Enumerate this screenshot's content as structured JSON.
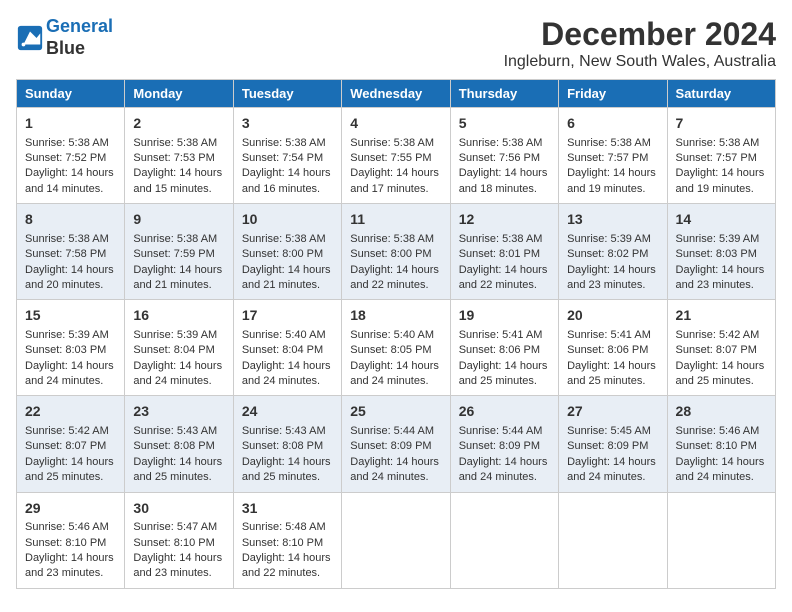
{
  "logo": {
    "line1": "General",
    "line2": "Blue"
  },
  "title": "December 2024",
  "subtitle": "Ingleburn, New South Wales, Australia",
  "days_of_week": [
    "Sunday",
    "Monday",
    "Tuesday",
    "Wednesday",
    "Thursday",
    "Friday",
    "Saturday"
  ],
  "weeks": [
    [
      {
        "day": "1",
        "sunrise": "5:38 AM",
        "sunset": "7:52 PM",
        "daylight": "14 hours and 14 minutes."
      },
      {
        "day": "2",
        "sunrise": "5:38 AM",
        "sunset": "7:53 PM",
        "daylight": "14 hours and 15 minutes."
      },
      {
        "day": "3",
        "sunrise": "5:38 AM",
        "sunset": "7:54 PM",
        "daylight": "14 hours and 16 minutes."
      },
      {
        "day": "4",
        "sunrise": "5:38 AM",
        "sunset": "7:55 PM",
        "daylight": "14 hours and 17 minutes."
      },
      {
        "day": "5",
        "sunrise": "5:38 AM",
        "sunset": "7:56 PM",
        "daylight": "14 hours and 18 minutes."
      },
      {
        "day": "6",
        "sunrise": "5:38 AM",
        "sunset": "7:57 PM",
        "daylight": "14 hours and 19 minutes."
      },
      {
        "day": "7",
        "sunrise": "5:38 AM",
        "sunset": "7:57 PM",
        "daylight": "14 hours and 19 minutes."
      }
    ],
    [
      {
        "day": "8",
        "sunrise": "5:38 AM",
        "sunset": "7:58 PM",
        "daylight": "14 hours and 20 minutes."
      },
      {
        "day": "9",
        "sunrise": "5:38 AM",
        "sunset": "7:59 PM",
        "daylight": "14 hours and 21 minutes."
      },
      {
        "day": "10",
        "sunrise": "5:38 AM",
        "sunset": "8:00 PM",
        "daylight": "14 hours and 21 minutes."
      },
      {
        "day": "11",
        "sunrise": "5:38 AM",
        "sunset": "8:00 PM",
        "daylight": "14 hours and 22 minutes."
      },
      {
        "day": "12",
        "sunrise": "5:38 AM",
        "sunset": "8:01 PM",
        "daylight": "14 hours and 22 minutes."
      },
      {
        "day": "13",
        "sunrise": "5:39 AM",
        "sunset": "8:02 PM",
        "daylight": "14 hours and 23 minutes."
      },
      {
        "day": "14",
        "sunrise": "5:39 AM",
        "sunset": "8:03 PM",
        "daylight": "14 hours and 23 minutes."
      }
    ],
    [
      {
        "day": "15",
        "sunrise": "5:39 AM",
        "sunset": "8:03 PM",
        "daylight": "14 hours and 24 minutes."
      },
      {
        "day": "16",
        "sunrise": "5:39 AM",
        "sunset": "8:04 PM",
        "daylight": "14 hours and 24 minutes."
      },
      {
        "day": "17",
        "sunrise": "5:40 AM",
        "sunset": "8:04 PM",
        "daylight": "14 hours and 24 minutes."
      },
      {
        "day": "18",
        "sunrise": "5:40 AM",
        "sunset": "8:05 PM",
        "daylight": "14 hours and 24 minutes."
      },
      {
        "day": "19",
        "sunrise": "5:41 AM",
        "sunset": "8:06 PM",
        "daylight": "14 hours and 25 minutes."
      },
      {
        "day": "20",
        "sunrise": "5:41 AM",
        "sunset": "8:06 PM",
        "daylight": "14 hours and 25 minutes."
      },
      {
        "day": "21",
        "sunrise": "5:42 AM",
        "sunset": "8:07 PM",
        "daylight": "14 hours and 25 minutes."
      }
    ],
    [
      {
        "day": "22",
        "sunrise": "5:42 AM",
        "sunset": "8:07 PM",
        "daylight": "14 hours and 25 minutes."
      },
      {
        "day": "23",
        "sunrise": "5:43 AM",
        "sunset": "8:08 PM",
        "daylight": "14 hours and 25 minutes."
      },
      {
        "day": "24",
        "sunrise": "5:43 AM",
        "sunset": "8:08 PM",
        "daylight": "14 hours and 25 minutes."
      },
      {
        "day": "25",
        "sunrise": "5:44 AM",
        "sunset": "8:09 PM",
        "daylight": "14 hours and 24 minutes."
      },
      {
        "day": "26",
        "sunrise": "5:44 AM",
        "sunset": "8:09 PM",
        "daylight": "14 hours and 24 minutes."
      },
      {
        "day": "27",
        "sunrise": "5:45 AM",
        "sunset": "8:09 PM",
        "daylight": "14 hours and 24 minutes."
      },
      {
        "day": "28",
        "sunrise": "5:46 AM",
        "sunset": "8:10 PM",
        "daylight": "14 hours and 24 minutes."
      }
    ],
    [
      {
        "day": "29",
        "sunrise": "5:46 AM",
        "sunset": "8:10 PM",
        "daylight": "14 hours and 23 minutes."
      },
      {
        "day": "30",
        "sunrise": "5:47 AM",
        "sunset": "8:10 PM",
        "daylight": "14 hours and 23 minutes."
      },
      {
        "day": "31",
        "sunrise": "5:48 AM",
        "sunset": "8:10 PM",
        "daylight": "14 hours and 22 minutes."
      },
      null,
      null,
      null,
      null
    ]
  ],
  "labels": {
    "sunrise": "Sunrise:",
    "sunset": "Sunset:",
    "daylight": "Daylight:"
  }
}
